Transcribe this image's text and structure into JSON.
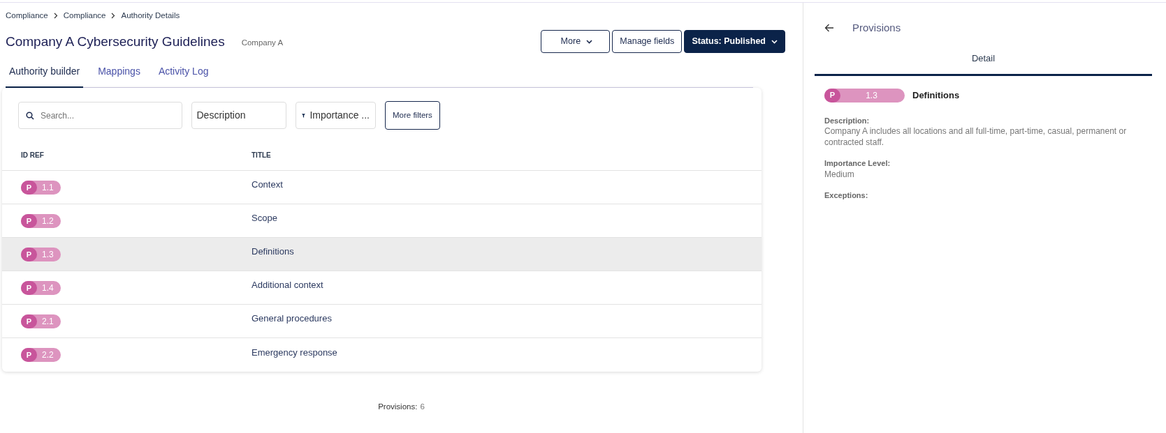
{
  "breadcrumbs": [
    "Compliance",
    "Compliance",
    "Authority Details"
  ],
  "title": "Company A Cybersecurity Guidelines",
  "subtitle": "Company A",
  "header_buttons": [
    {
      "label": "More",
      "kind": "outline",
      "caret": true
    },
    {
      "label": "Manage fields",
      "kind": "outline",
      "caret": false
    },
    {
      "label": "Status: Published",
      "kind": "solid",
      "caret": true
    }
  ],
  "tabs": [
    {
      "label": "Authority builder",
      "selected": true
    },
    {
      "label": "Mappings",
      "selected": false
    },
    {
      "label": "Activity Log",
      "selected": false
    }
  ],
  "filters": {
    "search": {
      "placeholder": "Search..."
    },
    "description": {
      "value": "Description"
    },
    "importance": {
      "label": "Importance ..."
    },
    "more_filters": {
      "label": "More filters"
    }
  },
  "table": {
    "columns": [
      "ID REF",
      "TITLE"
    ],
    "rows": [
      {
        "prefix": "P",
        "ref": "1.1",
        "title": "Context",
        "selected": false
      },
      {
        "prefix": "P",
        "ref": "1.2",
        "title": "Scope",
        "selected": false
      },
      {
        "prefix": "P",
        "ref": "1.3",
        "title": "Definitions",
        "selected": true
      },
      {
        "prefix": "P",
        "ref": "1.4",
        "title": "Additional context",
        "selected": false
      },
      {
        "prefix": "P",
        "ref": "2.1",
        "title": "General procedures",
        "selected": false
      },
      {
        "prefix": "P",
        "ref": "2.2",
        "title": "Emergency response",
        "selected": false
      }
    ]
  },
  "footer": {
    "label": "Provisions:",
    "count": "6"
  },
  "panel": {
    "title": "Provisions",
    "tabs": [
      {
        "label": "Detail",
        "selected": true
      }
    ],
    "badge": {
      "prefix": "P",
      "ref": "1.3"
    },
    "heading": "Definitions",
    "fields": [
      {
        "label": "Description:",
        "value": "Company A includes all locations and all full-time, part-time, casual, permanent or contracted staff."
      },
      {
        "label": "Importance Level:",
        "value": "Medium"
      },
      {
        "label": "Exceptions:"
      }
    ]
  }
}
